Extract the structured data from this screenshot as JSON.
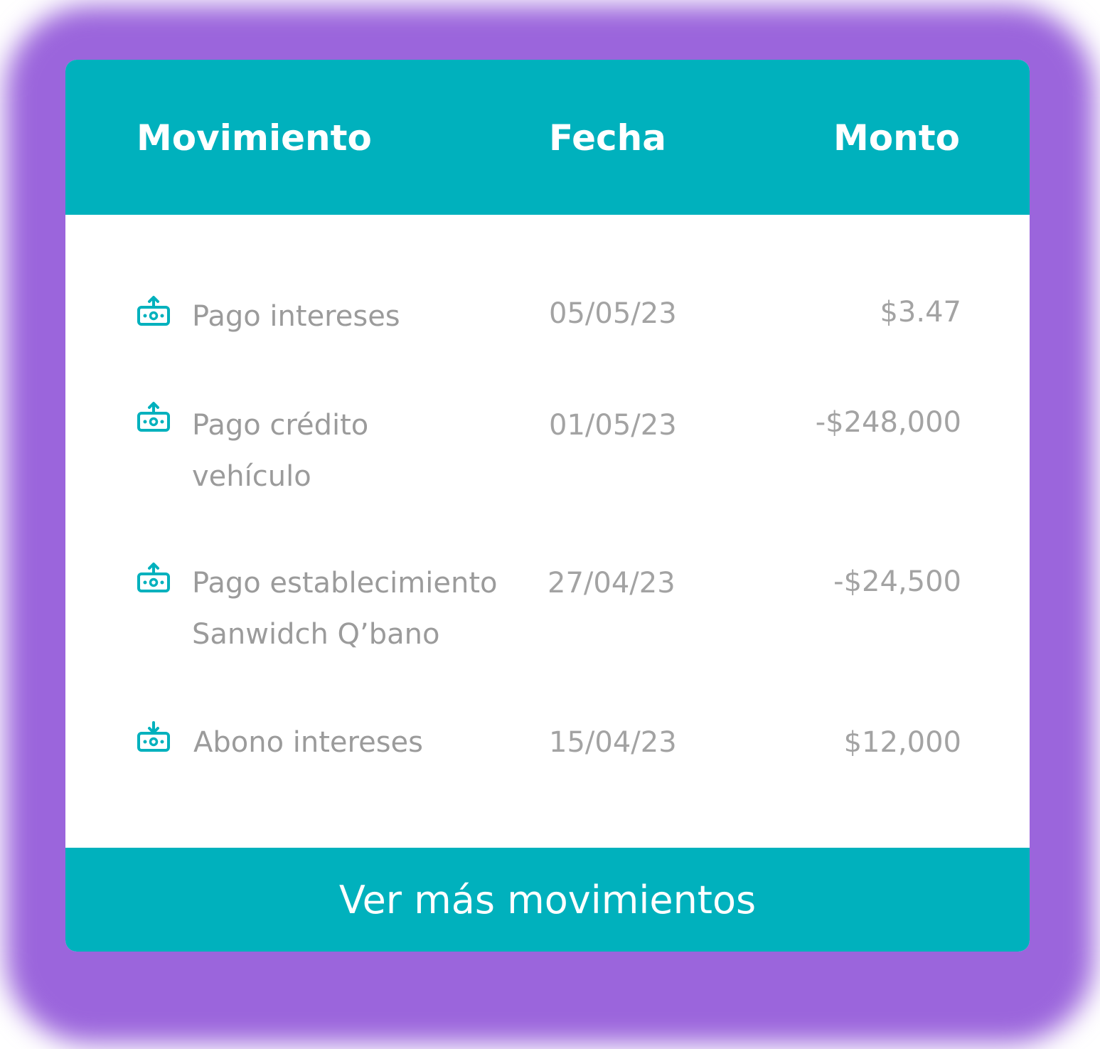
{
  "colors": {
    "accent": "#00b1bd",
    "background": "#9b65dc",
    "text_muted": "#9b9b9b"
  },
  "table": {
    "headers": {
      "movement": "Movimiento",
      "date": "Fecha",
      "amount": "Monto"
    },
    "rows": [
      {
        "icon": "money-out-icon",
        "description": "Pago intereses",
        "date": "05/05/23",
        "amount": "$3.47"
      },
      {
        "icon": "money-out-icon",
        "description": "Pago crédito vehículo",
        "date": "01/05/23",
        "amount": "-$248,000"
      },
      {
        "icon": "money-out-icon",
        "description": "Pago establecimiento Sanwidch Q’bano",
        "date": "27/04/23",
        "amount": "-$24,500"
      },
      {
        "icon": "money-in-icon",
        "description": "Abono intereses",
        "date": "15/04/23",
        "amount": "$12,000"
      }
    ]
  },
  "footer": {
    "see_more_label": "Ver más movimientos"
  }
}
